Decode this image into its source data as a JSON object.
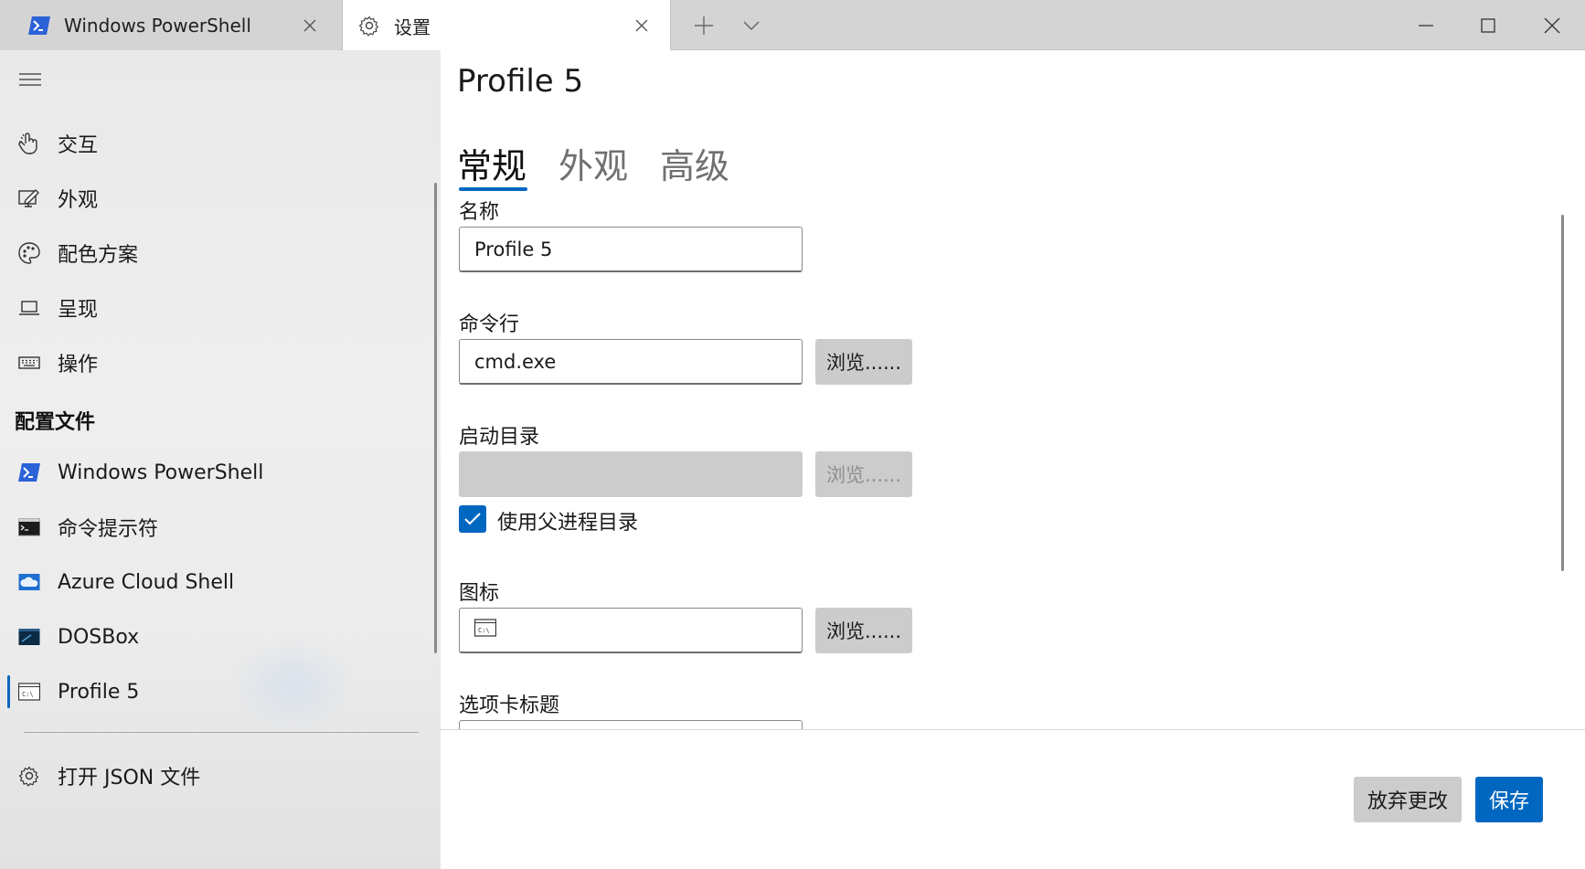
{
  "tabs": [
    {
      "label": "Windows PowerShell",
      "icon": "powershell-icon"
    },
    {
      "label": "设置",
      "icon": "gear-icon"
    }
  ],
  "sidebar": {
    "items": [
      {
        "label": "交互",
        "icon": "hand-pointer-icon"
      },
      {
        "label": "外观",
        "icon": "pen-monitor-icon"
      },
      {
        "label": "配色方案",
        "icon": "palette-icon"
      },
      {
        "label": "呈现",
        "icon": "laptop-icon"
      },
      {
        "label": "操作",
        "icon": "keyboard-icon"
      }
    ],
    "section_title": "配置文件",
    "profiles": [
      {
        "label": "Windows PowerShell",
        "icon": "powershell-icon"
      },
      {
        "label": "命令提示符",
        "icon": "cmd-icon"
      },
      {
        "label": "Azure Cloud Shell",
        "icon": "azure-cloud-shell-icon"
      },
      {
        "label": "DOSBox",
        "icon": "dosbox-icon"
      },
      {
        "label": "Profile 5",
        "icon": "cmd-prompt-icon"
      }
    ],
    "footer_item": {
      "label": "打开 JSON 文件",
      "icon": "gear-icon"
    }
  },
  "main": {
    "title": "Profile 5",
    "pivots": [
      "常规",
      "外观",
      "高级"
    ],
    "fields": {
      "name": {
        "label": "名称",
        "value": "Profile 5"
      },
      "commandline": {
        "label": "命令行",
        "value": "cmd.exe",
        "browse": "浏览......"
      },
      "startdir": {
        "label": "启动目录",
        "value": "",
        "browse": "浏览......"
      },
      "use_parent": {
        "label": "使用父进程目录",
        "checked": true
      },
      "icon": {
        "label": "图标",
        "value_icon": "cmd-prompt-icon",
        "browse": "浏览......"
      },
      "tab_title": {
        "label": "选项卡标题"
      }
    },
    "buttons": {
      "discard": "放弃更改",
      "save": "保存"
    }
  },
  "colors": {
    "accent": "#0067c0",
    "sidebar_bg": "#ececec",
    "titlebar_bg": "#d4d4d4",
    "button_gray": "#cccccc"
  }
}
